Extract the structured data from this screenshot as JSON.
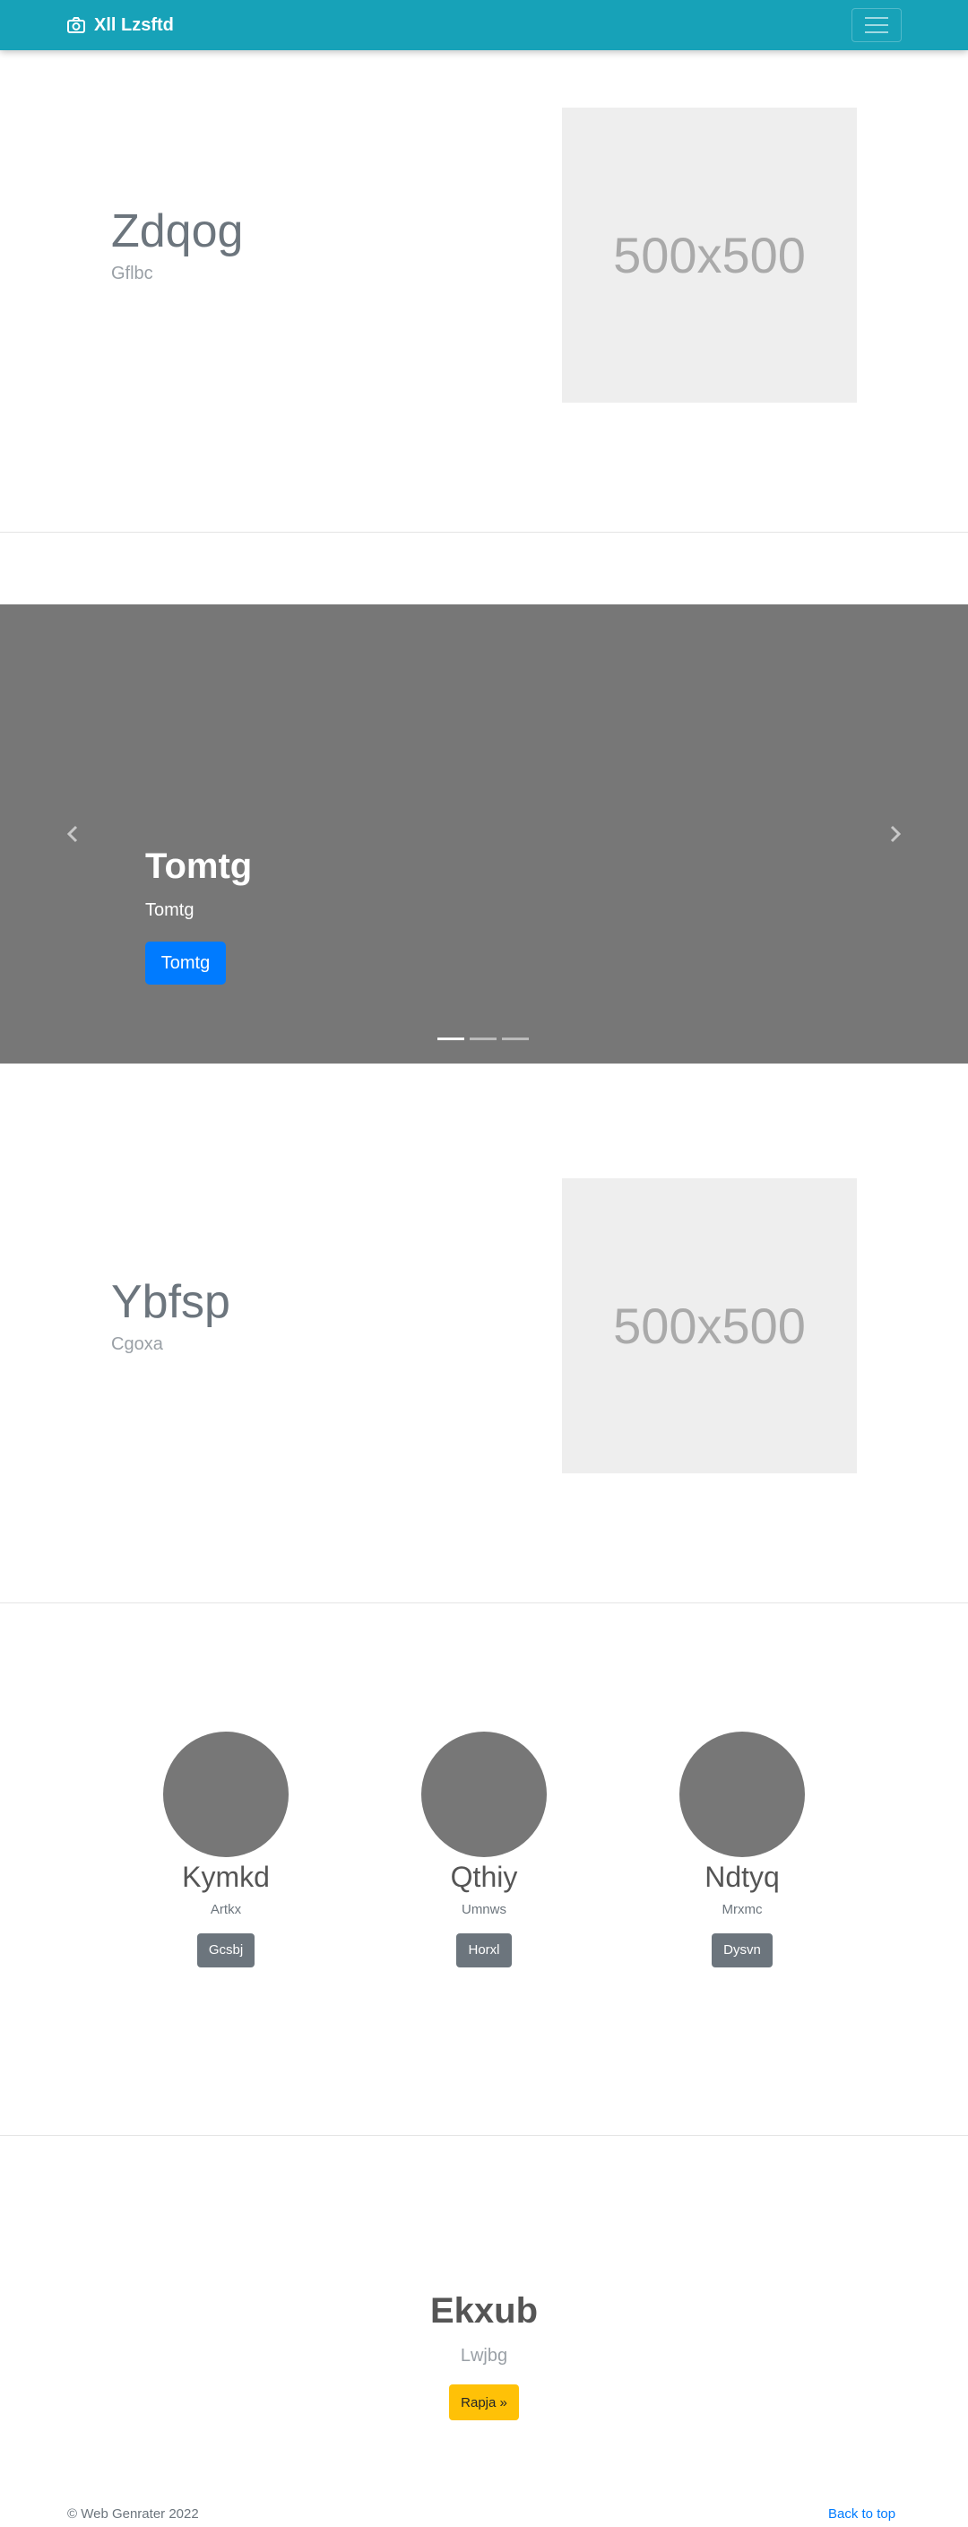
{
  "navbar": {
    "brand": "Xll Lzsftd",
    "brand_icon": "camera-icon",
    "toggler_icon": "hamburger-menu-icon",
    "background": "#17a2b8"
  },
  "feature1": {
    "title": "Zdqog",
    "subtitle": "Gflbc",
    "image_text": "500x500"
  },
  "carousel": {
    "title": "Tomtg",
    "text": "Tomtg",
    "button": "Tomtg",
    "prev_icon": "chevron-left-icon",
    "next_icon": "chevron-right-icon",
    "indicators": 3,
    "active_indicator": 1,
    "background": "#777777"
  },
  "feature2": {
    "title": "Ybfsp",
    "subtitle": "Cgoxa",
    "image_text": "500x500"
  },
  "team": [
    {
      "name": "Kymkd",
      "sub": "Artkx",
      "button": "Gcsbj"
    },
    {
      "name": "Qthiy",
      "sub": "Umnws",
      "button": "Horxl"
    },
    {
      "name": "Ndtyq",
      "sub": "Mrxmc",
      "button": "Dysvn"
    }
  ],
  "cta": {
    "title": "Ekxub",
    "subtitle": "Lwjbg",
    "button": "Rapja »"
  },
  "footer": {
    "copyright": "© Web Genrater 2022",
    "back_to_top": "Back to top"
  }
}
